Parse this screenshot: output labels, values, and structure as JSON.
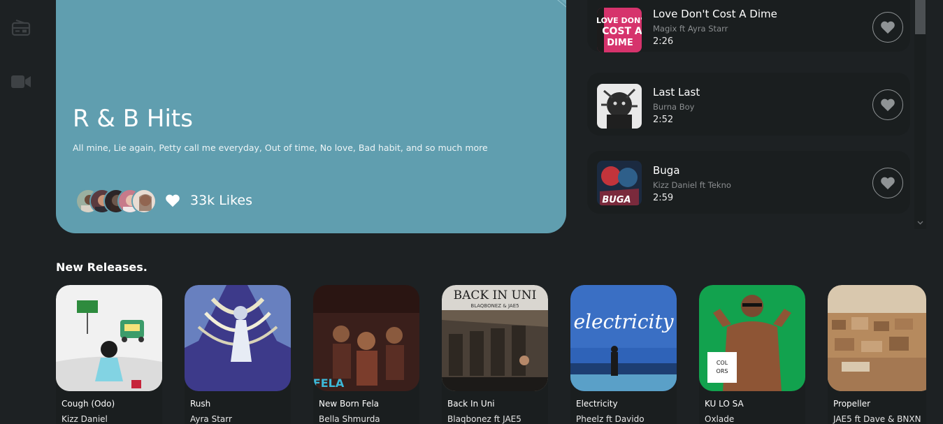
{
  "sidebar": {
    "icons": [
      "radio-icon",
      "video-icon"
    ]
  },
  "hero": {
    "title": "R & B Hits",
    "description": "All mine, Lie again, Petty call me everyday, Out of time, No love, Bad habit, and so much more",
    "likes": "33k Likes",
    "bg_color": "#609eaf"
  },
  "top_charts": [
    {
      "title": "Love Don't Cost A Dime",
      "artist": "Magix ft Ayra Starr",
      "duration": "2:26",
      "cover_text": "LOVE DON'T COST A DIME"
    },
    {
      "title": "Last Last",
      "artist": "Burna Boy",
      "duration": "2:52"
    },
    {
      "title": "Buga",
      "artist": "Kizz Daniel ft Tekno",
      "duration": "2:59",
      "cover_text": "BUGA"
    }
  ],
  "new_releases": {
    "heading": "New Releases.",
    "items": [
      {
        "title": "Cough (Odo)",
        "artist": "Kizz Daniel"
      },
      {
        "title": "Rush",
        "artist": "Ayra Starr"
      },
      {
        "title": "New Born Fela",
        "artist": "Bella Shmurda",
        "cover_text": "FELA"
      },
      {
        "title": "Back In Uni",
        "artist": "Blaqbonez ft JAE5",
        "cover_text": "BACK IN UNI",
        "cover_subtext": "BLAQBONEZ & JAE5"
      },
      {
        "title": "Electricity",
        "artist": "Pheelz ft Davido",
        "cover_text": "electricity"
      },
      {
        "title": "KU LO SA",
        "artist": "Oxlade",
        "cover_text": "COL ORS"
      },
      {
        "title": "Propeller",
        "artist": "JAE5 ft Dave & BNXN"
      }
    ]
  }
}
